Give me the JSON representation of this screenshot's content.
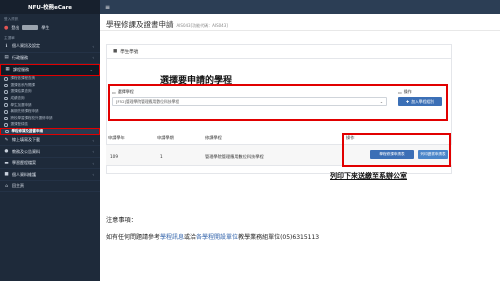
{
  "sidebar": {
    "brand": "NFU-校務eCare",
    "caption_top": "登入資訊",
    "user_prefix": "登出",
    "user_suffix": "學生",
    "caption_main": "主選單",
    "items": [
      {
        "label": "個人資訊及設定",
        "icon": "info-icon",
        "glyph": "ℹ"
      },
      {
        "label": "行政服務",
        "icon": "briefcase-icon",
        "glyph": "▤"
      },
      {
        "label": "課程服務",
        "icon": "book-icon",
        "glyph": "▦",
        "active": true
      }
    ],
    "sub_items": [
      {
        "label": "課程依課程查詢"
      },
      {
        "label": "選課依系所開課"
      },
      {
        "label": "選課結果查詢"
      },
      {
        "label": "成績查詢"
      },
      {
        "label": "學生加選申請"
      },
      {
        "label": "暑期先修課程申請"
      },
      {
        "label": "跨校學習課程校外選修申請"
      },
      {
        "label": "選課登錄區"
      },
      {
        "label": "學程修課及證書申請",
        "active": true
      }
    ],
    "items_after": [
      {
        "label": "線上填寫及下載",
        "icon": "edit-icon",
        "glyph": "✎"
      },
      {
        "label": "教務及公告資料",
        "icon": "bell-icon",
        "glyph": "●"
      },
      {
        "label": "學習歷程檔案",
        "icon": "folder-icon",
        "glyph": "▬"
      },
      {
        "label": "個人資料維護",
        "icon": "user-icon",
        "glyph": "■"
      },
      {
        "label": "回主頁",
        "icon": "home-icon",
        "glyph": "⌂"
      }
    ]
  },
  "topbar": {
    "menu_glyph": "≡"
  },
  "page": {
    "title": "學程修課及證書申請",
    "subtitle": "AIS043[功能代碼：AIS043]"
  },
  "panel": {
    "title": "學生學號",
    "program_label": "選擇學程",
    "action_label": "操作",
    "select_value": "[F52]管理學院管理應用數位科技學程",
    "add_button": "加入學程組別",
    "annotation_select": "選擇要申請的學程"
  },
  "table": {
    "headers": [
      "申請學年",
      "申請學期",
      "修課學程",
      "操作"
    ],
    "rows": [
      {
        "year": "109",
        "term": "1",
        "program": "管理學院管理應用數位科技學程",
        "btn1": "學程修課申請表",
        "btn2": "列印證書申請表"
      }
    ]
  },
  "annotation_print": "列印下來送繳至系辦公室",
  "notice": {
    "title": "注意事項：",
    "text_a": "如有任何問題請參考",
    "link_a": "學程訊息",
    "text_b": "或洽",
    "link_b": "各學程開設單位",
    "text_c": "教學業務組單位(05)6315113"
  },
  "colors": {
    "accent": "#3b6fb6",
    "highlight": "#e10000",
    "sidebar": "#1e2a3a"
  }
}
